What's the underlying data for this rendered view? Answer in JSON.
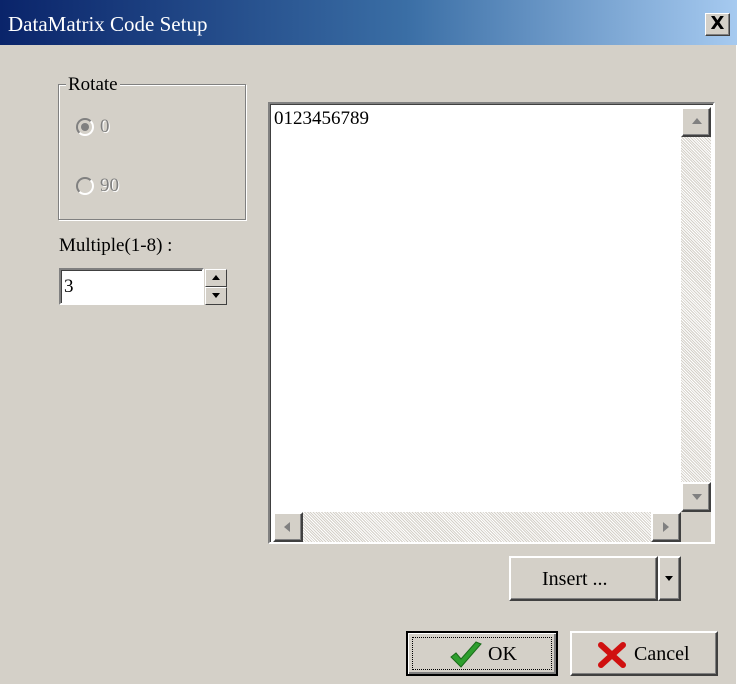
{
  "window": {
    "title": "DataMatrix Code Setup",
    "close_label": "X"
  },
  "rotate": {
    "group_label": "Rotate",
    "options": [
      {
        "label": "0",
        "selected": true,
        "enabled": false
      },
      {
        "label": "90",
        "selected": false,
        "enabled": false
      }
    ]
  },
  "multiple": {
    "label": "Multiple(1-8) :",
    "value": "3"
  },
  "content": {
    "text": "0123456789"
  },
  "insert_button": {
    "label": "Insert ...",
    "arrow": "dropdown-arrow-icon"
  },
  "ok_button": {
    "label": "OK",
    "icon": "checkmark-icon",
    "icon_color": "#2e9e2e"
  },
  "cancel_button": {
    "label": "Cancel",
    "icon": "x-mark-icon",
    "icon_color": "#d01010"
  },
  "colors": {
    "title_start": "#0a246a",
    "title_end": "#a6caf0",
    "face": "#d4d0c8"
  }
}
